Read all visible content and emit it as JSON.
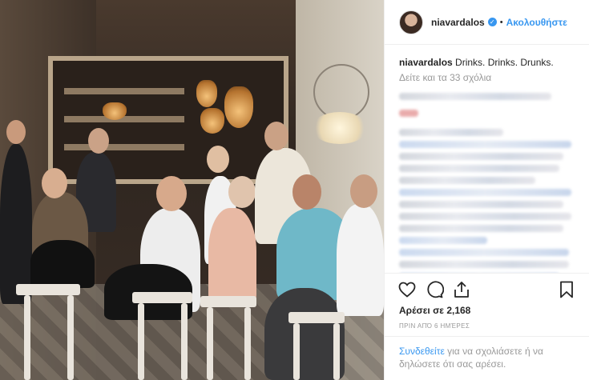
{
  "post": {
    "username": "niavardalos",
    "verified_glyph": "✓",
    "separator": "•",
    "follow_label": "Ακολουθήστε",
    "caption_user": "niavardalos",
    "caption_text": " Drinks. Drinks. Drunks.",
    "view_all_comments": "Δείτε και τα 33 σχόλια",
    "likes": "Αρέσει σε 2,168",
    "timestamp": "ΠΡΙΝ ΑΠΌ 6 ΗΜΈΡΕΣ",
    "login_link": "Συνδεθείτε",
    "login_text": " για να σχολιάσετε ή να δηλώσετε ότι σας αρέσει."
  },
  "icons": {
    "verified": "verified-badge-icon",
    "like": "heart-icon",
    "comment": "comment-bubble-icon",
    "share": "share-icon",
    "save": "bookmark-icon"
  },
  "colors": {
    "link": "#3897f0",
    "muted": "#999999",
    "text": "#262626",
    "border": "#efefef"
  }
}
